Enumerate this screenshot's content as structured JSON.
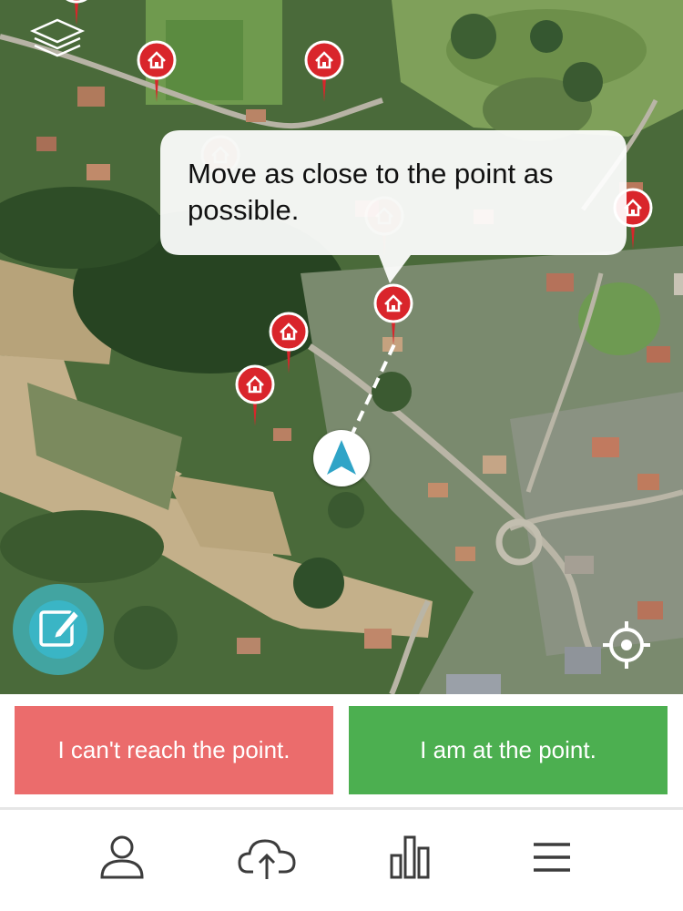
{
  "map": {
    "tooltip_text": "Move as close to the point as possible.",
    "pin_color": "#d9252b",
    "arrow_color": "#2fa4c7"
  },
  "actions": {
    "cant_reach_label": "I can't reach the point.",
    "at_point_label": "I am at the point.",
    "cant_reach_color": "#eb6c6c",
    "at_point_color": "#4caf50"
  },
  "nav": {
    "items": [
      {
        "icon": "user-icon"
      },
      {
        "icon": "cloud-upload-icon"
      },
      {
        "icon": "bar-chart-icon"
      },
      {
        "icon": "menu-icon"
      }
    ]
  }
}
